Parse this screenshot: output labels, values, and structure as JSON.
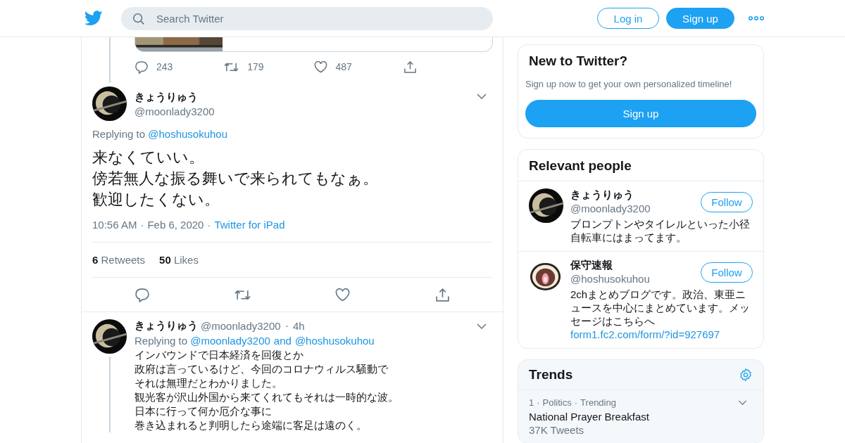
{
  "separator": "·",
  "header": {
    "search": {
      "placeholder": "Search Twitter"
    },
    "buttons": [
      {
        "label": "Log in",
        "kind": "outline"
      },
      {
        "label": "Sign up",
        "kind": "filled"
      }
    ]
  },
  "previous_tweet": {
    "actions": [
      {
        "kind": "reply",
        "count": "243"
      },
      {
        "kind": "retweet",
        "count": "179"
      },
      {
        "kind": "like",
        "count": "487"
      },
      {
        "kind": "share"
      }
    ]
  },
  "focused_tweet": {
    "name": "きょうりゅう",
    "handle": "@moonlady3200",
    "replying_label": "Replying to",
    "replying_to": [
      "@hoshusokuhou"
    ],
    "lines": [
      "来なくていい。",
      "傍若無人な振る舞いで来られてもなぁ。",
      "歓迎したくない。"
    ],
    "time": "10:56 AM",
    "date": "Feb 6, 2020",
    "source": "Twitter for iPad",
    "stats": [
      {
        "count": "6",
        "label": "Retweets"
      },
      {
        "count": "50",
        "label": "Likes"
      }
    ],
    "actions": [
      {
        "kind": "reply"
      },
      {
        "kind": "retweet"
      },
      {
        "kind": "like"
      },
      {
        "kind": "share"
      }
    ]
  },
  "reply_tweet": {
    "name": "きょうりゅう",
    "handle": "@moonlady3200",
    "age": "4h",
    "replying_label": "Replying to",
    "replying_to": [
      "@moonlady3200",
      "@hoshusokuhou"
    ],
    "joiner": "and",
    "lines": [
      "インバウンドで日本経済を回復とか",
      "政府は言っているけど、今回のコロナウィルス騒動で",
      "それは無理だとわかりました。",
      "観光客が沢山外国から来てくれてもそれは一時的な波。",
      "日本に行って何か厄介な事に",
      "巻き込まれると判明したら途端に客足は遠のく。"
    ]
  },
  "signup_card": {
    "title": "New to Twitter?",
    "text": "Sign up now to get your own personalized timeline!",
    "button": "Sign up"
  },
  "relevant_people": {
    "title": "Relevant people",
    "people": [
      {
        "name": "きょうりゅう",
        "handle": "@moonlady3200",
        "follow": "Follow",
        "bio": "ブロンプトンやタイレルといった小径自転車にはまってます。"
      },
      {
        "name": "保守速報",
        "handle": "@hoshusokuhou",
        "follow": "Follow",
        "bio": "2chまとめブログです。政治、東亜ニュースを中心にまとめています。メッセージはこちらへ",
        "link": "form1.fc2.com/form/?id=927697"
      }
    ]
  },
  "trends": {
    "title": "Trends",
    "items": [
      {
        "rank": "1",
        "category": "Politics",
        "status": "Trending",
        "name": "National Prayer Breakfast",
        "count": "37K Tweets"
      }
    ]
  }
}
